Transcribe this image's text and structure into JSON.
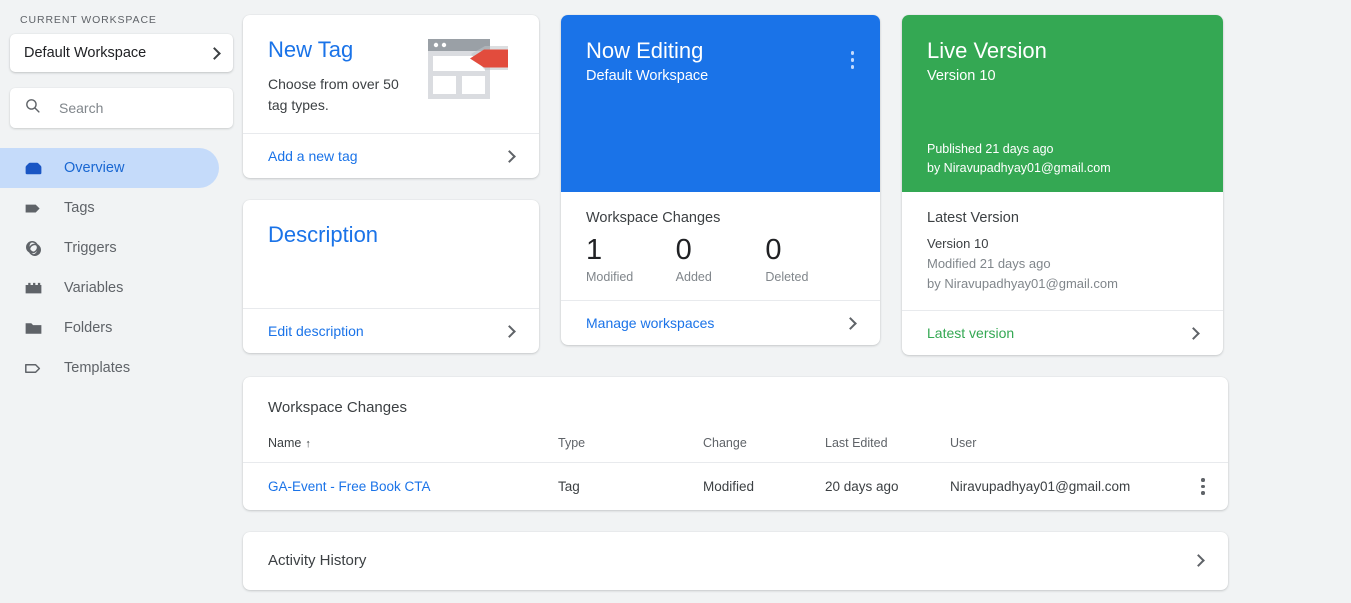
{
  "sidebar": {
    "workspace_label": "CURRENT WORKSPACE",
    "workspace_name": "Default Workspace",
    "search_placeholder": "Search",
    "items": [
      {
        "label": "Overview",
        "icon": "overview-icon",
        "active": true
      },
      {
        "label": "Tags",
        "icon": "tag-icon",
        "active": false
      },
      {
        "label": "Triggers",
        "icon": "trigger-icon",
        "active": false
      },
      {
        "label": "Variables",
        "icon": "variable-icon",
        "active": false
      },
      {
        "label": "Folders",
        "icon": "folder-icon",
        "active": false
      },
      {
        "label": "Templates",
        "icon": "template-icon",
        "active": false
      }
    ]
  },
  "new_tag_card": {
    "title": "New Tag",
    "subtitle": "Choose from over 50 tag types.",
    "footer_link": "Add a new tag"
  },
  "description_card": {
    "title": "Description",
    "footer_link": "Edit description"
  },
  "now_editing_card": {
    "title": "Now Editing",
    "subtitle": "Default Workspace",
    "changes_title": "Workspace Changes",
    "stats": [
      {
        "value": "1",
        "label": "Modified"
      },
      {
        "value": "0",
        "label": "Added"
      },
      {
        "value": "0",
        "label": "Deleted"
      }
    ],
    "footer_link": "Manage workspaces"
  },
  "live_version_card": {
    "title": "Live Version",
    "subtitle": "Version 10",
    "published": "Published 21 days ago",
    "published_by": "by Niravupadhyay01@gmail.com",
    "latest_title": "Latest Version",
    "latest_version": "Version 10",
    "latest_modified": "Modified 21 days ago",
    "latest_by": "by Niravupadhyay01@gmail.com",
    "footer_link": "Latest version"
  },
  "changes_table": {
    "title": "Workspace Changes",
    "sort_indicator": "↑",
    "columns": [
      "Name",
      "Type",
      "Change",
      "Last Edited",
      "User"
    ],
    "rows": [
      {
        "name": "GA-Event - Free Book CTA",
        "type": "Tag",
        "change": "Modified",
        "last_edited": "20 days ago",
        "user": "Niravupadhyay01@gmail.com"
      }
    ]
  },
  "activity_history": {
    "title": "Activity History"
  },
  "colors": {
    "blue": "#1a73e8",
    "green": "#34a853",
    "red": "#e24c3d",
    "active_nav_bg": "#c5dbfa",
    "page_bg": "#f1f3f4"
  }
}
